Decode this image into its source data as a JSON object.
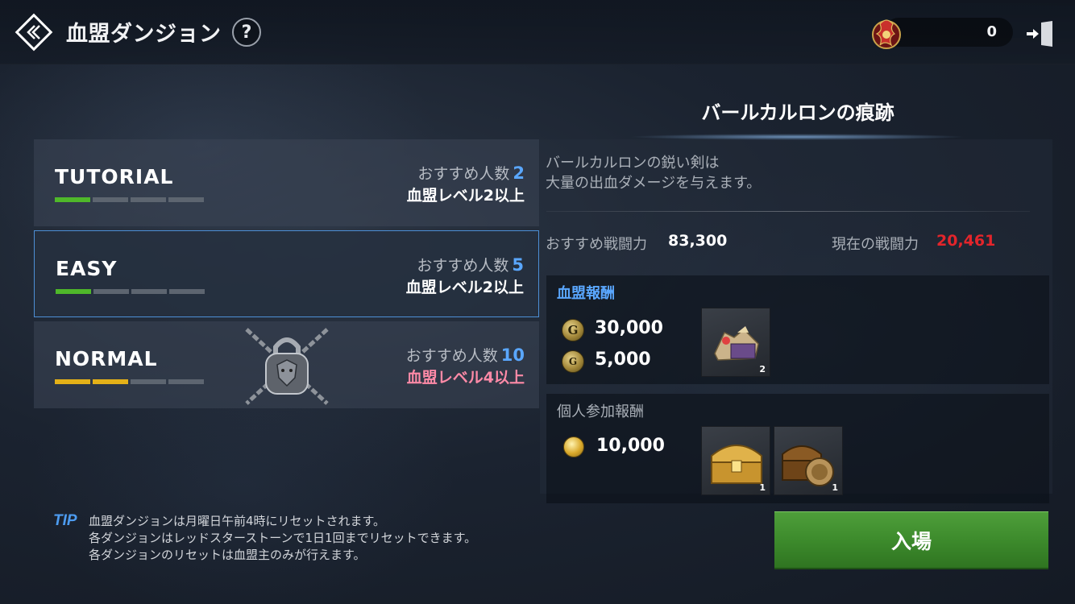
{
  "header": {
    "title": "血盟ダンジョン",
    "help_label": "?",
    "currency_value": "0",
    "icons": {
      "back": "back-chevron-icon",
      "currency": "dragon-emblem-icon",
      "exit": "exit-door-icon"
    }
  },
  "difficulties": [
    {
      "name": "TUTORIAL",
      "rec_label": "おすすめ人数",
      "rec_count": "2",
      "requirement": "血盟レベル2以上",
      "level_filled": 1,
      "level_total": 4,
      "bar_color": "#4fb82a",
      "selected": false,
      "locked": false
    },
    {
      "name": "EASY",
      "rec_label": "おすすめ人数",
      "rec_count": "5",
      "requirement": "血盟レベル2以上",
      "level_filled": 1,
      "level_total": 4,
      "bar_color": "#4fb82a",
      "selected": true,
      "locked": false
    },
    {
      "name": "NORMAL",
      "rec_label": "おすすめ人数",
      "rec_count": "10",
      "requirement": "血盟レベル4以上",
      "level_filled": 2,
      "level_total": 4,
      "bar_color": "#e4b118",
      "selected": false,
      "locked": true
    }
  ],
  "dungeon": {
    "name": "バールカルロンの痕跡",
    "description_line1": "バールカルロンの鋭い剣は",
    "description_line2": "大量の出血ダメージを与えます。",
    "recommended_power_label": "おすすめ戦闘力",
    "recommended_power": "83,300",
    "current_power_label": "現在の戦闘力",
    "current_power": "20,461"
  },
  "clan_reward": {
    "title": "血盟報酬",
    "gold_amount": "30,000",
    "exp_amount": "5,000",
    "item_count": "2",
    "icons": {
      "gold": "clan-gold-coin-icon",
      "exp": "clan-exp-coin-icon",
      "item": "treasure-pile-icon"
    }
  },
  "personal_reward": {
    "title": "個人参加報酬",
    "gold_amount": "10,000",
    "items": [
      {
        "icon": "gold-chest-icon",
        "count": "1"
      },
      {
        "icon": "lion-chest-icon",
        "count": "1"
      }
    ]
  },
  "enter_button": "入場",
  "tip": {
    "label": "TIP",
    "lines": [
      "血盟ダンジョンは月曜日午前4時にリセットされます。",
      "各ダンジョンはレッドスターストーンで1日1回までリセットできます。",
      "各ダンジョンのリセットは血盟主のみが行えます。"
    ]
  },
  "colors": {
    "accent_blue": "#5aa7ff",
    "danger_red": "#e3252b",
    "enter_green": "#3d8b2c",
    "locked_pink": "#ff8aa7"
  }
}
